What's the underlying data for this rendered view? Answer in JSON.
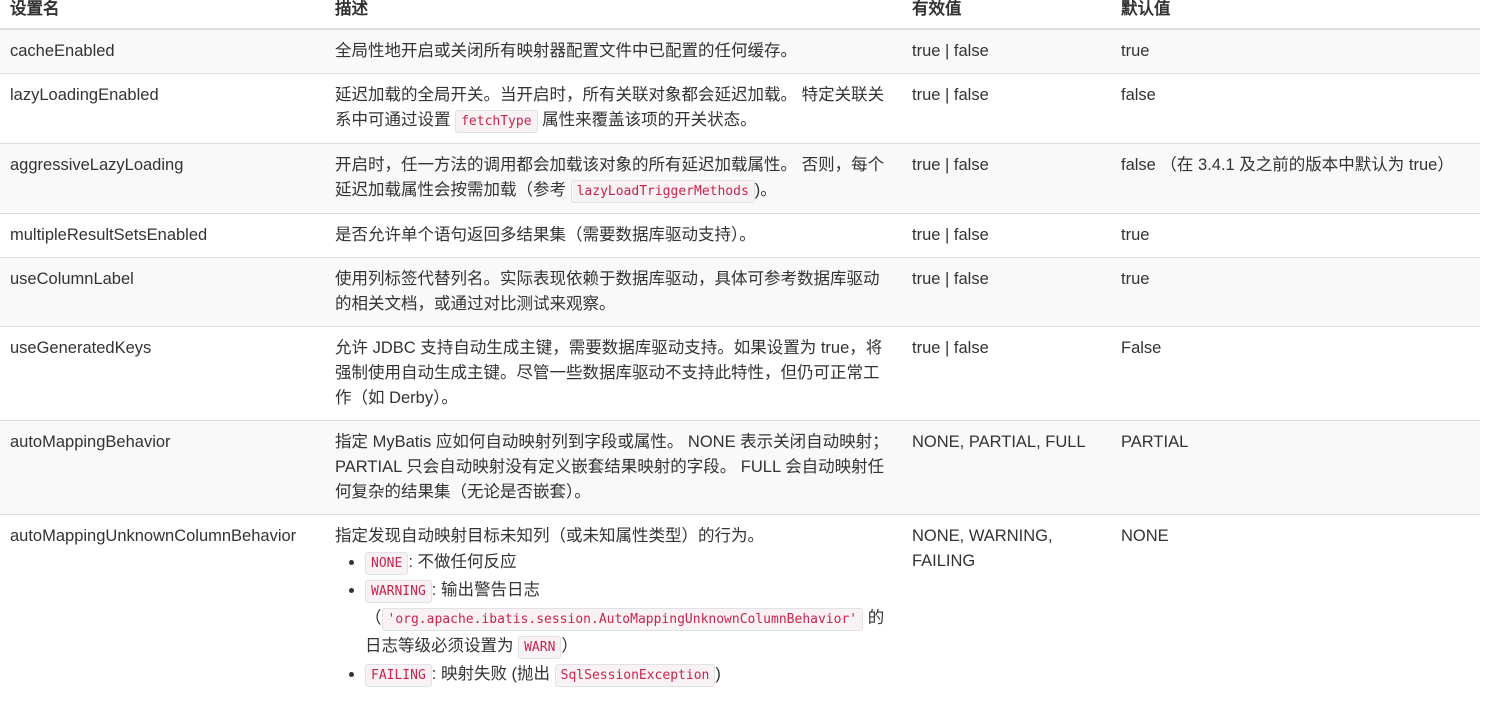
{
  "headers": [
    "设置名",
    "描述",
    "有效值",
    "默认值"
  ],
  "rows": [
    {
      "name": "cacheEnabled",
      "desc_parts": [
        {
          "t": "全局性地开启或关闭所有映射器配置文件中已配置的任何缓存。"
        }
      ],
      "valid": "true | false",
      "default": "true"
    },
    {
      "name": "lazyLoadingEnabled",
      "desc_parts": [
        {
          "t": "延迟加载的全局开关。当开启时，所有关联对象都会延迟加载。 特定关联关系中可通过设置 "
        },
        {
          "code": "fetchType"
        },
        {
          "t": " 属性来覆盖该项的开关状态。"
        }
      ],
      "valid": "true | false",
      "default": "false"
    },
    {
      "name": "aggressiveLazyLoading",
      "desc_parts": [
        {
          "t": "开启时，任一方法的调用都会加载该对象的所有延迟加载属性。 否则，每个延迟加载属性会按需加载（参考 "
        },
        {
          "code": "lazyLoadTriggerMethods"
        },
        {
          "t": ")。"
        }
      ],
      "valid": "true | false",
      "default": "false （在 3.4.1 及之前的版本中默认为 true）"
    },
    {
      "name": "multipleResultSetsEnabled",
      "desc_parts": [
        {
          "t": "是否允许单个语句返回多结果集（需要数据库驱动支持）。"
        }
      ],
      "valid": "true | false",
      "default": "true"
    },
    {
      "name": "useColumnLabel",
      "desc_parts": [
        {
          "t": "使用列标签代替列名。实际表现依赖于数据库驱动，具体可参考数据库驱动的相关文档，或通过对比测试来观察。"
        }
      ],
      "valid": "true | false",
      "default": "true"
    },
    {
      "name": "useGeneratedKeys",
      "desc_parts": [
        {
          "t": "允许 JDBC 支持自动生成主键，需要数据库驱动支持。如果设置为 true，将强制使用自动生成主键。尽管一些数据库驱动不支持此特性，但仍可正常工作（如 Derby）。"
        }
      ],
      "valid": "true | false",
      "default": "False"
    },
    {
      "name": "autoMappingBehavior",
      "desc_parts": [
        {
          "t": "指定 MyBatis 应如何自动映射列到字段或属性。 NONE 表示关闭自动映射；PARTIAL 只会自动映射没有定义嵌套结果映射的字段。 FULL 会自动映射任何复杂的结果集（无论是否嵌套）。"
        }
      ],
      "valid": "NONE, PARTIAL, FULL",
      "default": "PARTIAL"
    },
    {
      "name": "autoMappingUnknownColumnBehavior",
      "desc_parts": [
        {
          "t": "指定发现自动映射目标未知列（或未知属性类型）的行为。"
        }
      ],
      "list": [
        [
          {
            "code": "NONE"
          },
          {
            "t": ": 不做任何反应"
          }
        ],
        [
          {
            "code": "WARNING"
          },
          {
            "t": ": 输出警告日志（"
          },
          {
            "code": "'org.apache.ibatis.session.AutoMappingUnknownColumnBehavior'"
          },
          {
            "t": " 的日志等级必须设置为 "
          },
          {
            "code": "WARN"
          },
          {
            "t": "）"
          }
        ],
        [
          {
            "code": "FAILING"
          },
          {
            "t": ": 映射失败 (抛出 "
          },
          {
            "code": "SqlSessionException"
          },
          {
            "t": ")"
          }
        ]
      ],
      "valid": "NONE, WARNING, FAILING",
      "default": "NONE"
    }
  ]
}
